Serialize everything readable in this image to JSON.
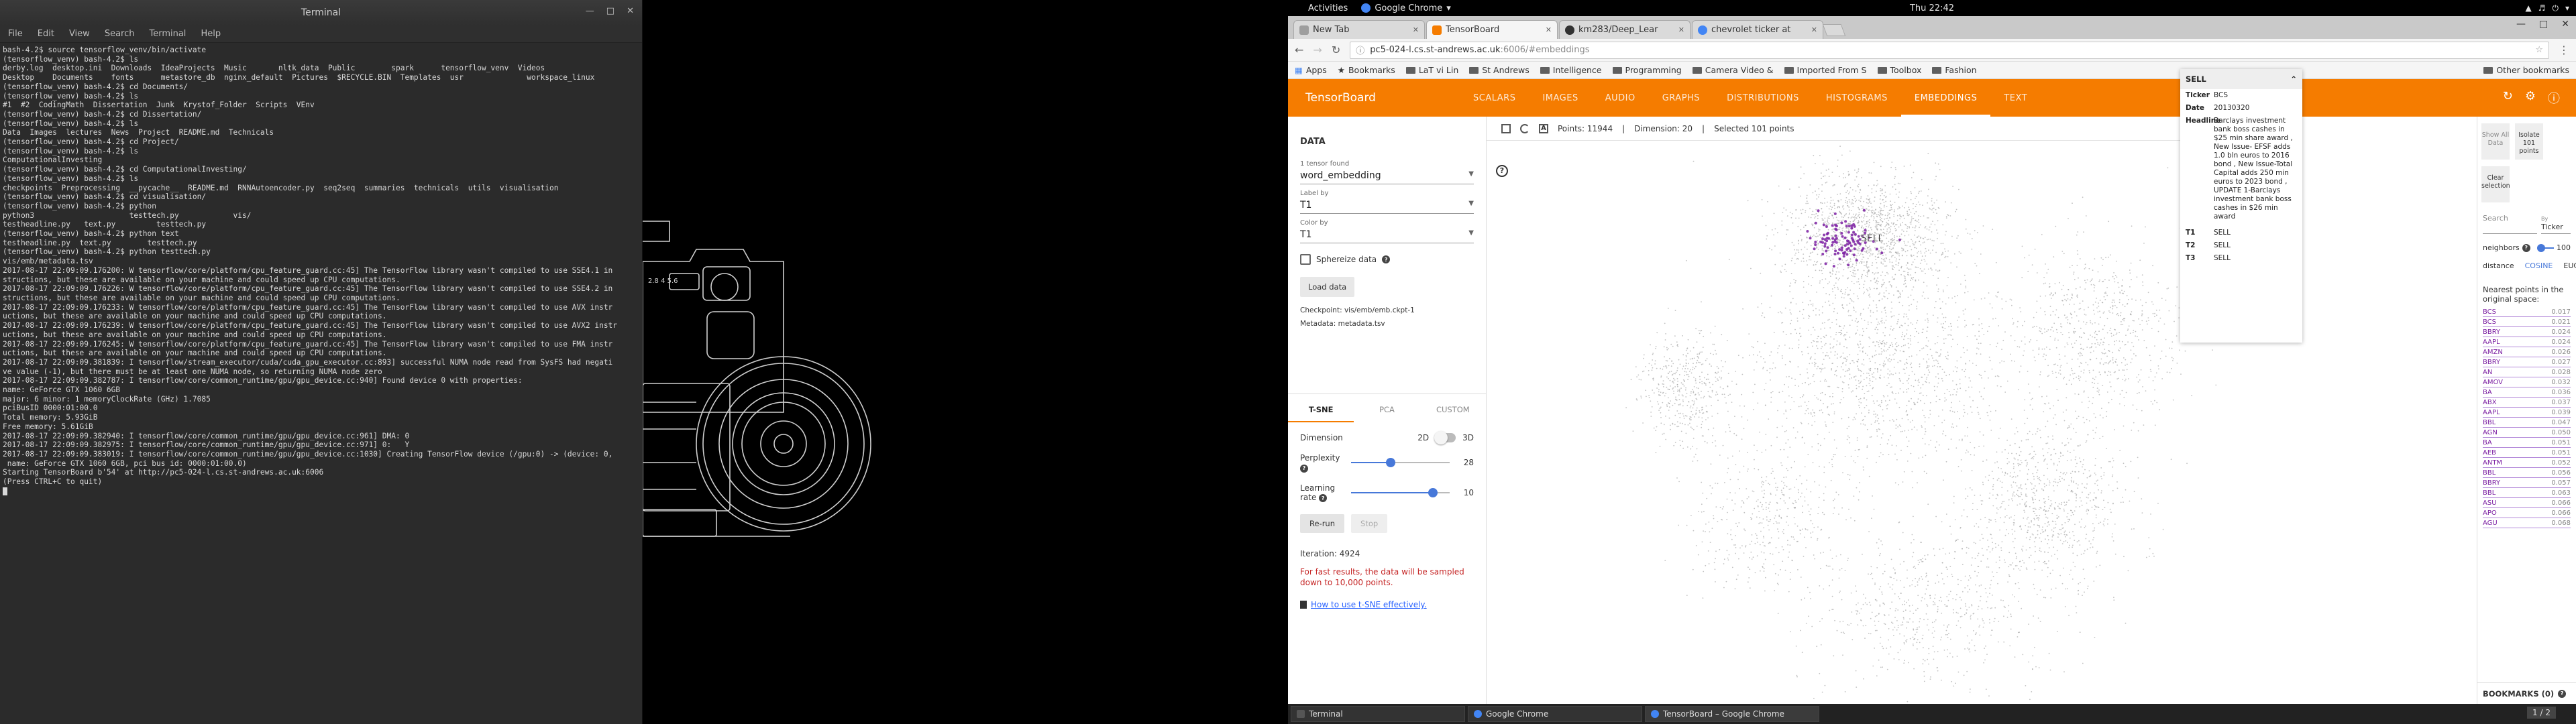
{
  "terminal": {
    "title": "Terminal",
    "menu": [
      "File",
      "Edit",
      "View",
      "Search",
      "Terminal",
      "Help"
    ],
    "lines": [
      "bash-4.2$ source tensorflow_venv/bin/activate",
      "(tensorflow_venv) bash-4.2$ ls",
      "derby.log  desktop.ini  Downloads  IdeaProjects  Music       nltk_data  Public        spark      tensorflow_venv  Videos",
      "Desktop    Documents    fonts      metastore_db  nginx_default  Pictures  $RECYCLE.BIN  Templates  usr              workspace_linux",
      "(tensorflow_venv) bash-4.2$ cd Documents/",
      "(tensorflow_venv) bash-4.2$ ls",
      "#1  #2  CodingMath  Dissertation  Junk  Krystof_Folder  Scripts  VEnv",
      "(tensorflow_venv) bash-4.2$ cd Dissertation/",
      "(tensorflow_venv) bash-4.2$ ls",
      "Data  Images  lectures  News  Project  README.md  Technicals",
      "(tensorflow_venv) bash-4.2$ cd Project/",
      "(tensorflow_venv) bash-4.2$ ls",
      "ComputationalInvesting",
      "(tensorflow_venv) bash-4.2$ cd ComputationalInvesting/",
      "(tensorflow_venv) bash-4.2$ ls",
      "checkpoints  Preprocessing  __pycache__  README.md  RNNAutoencoder.py  seq2seq  summaries  technicals  utils  visualisation",
      "(tensorflow_venv) bash-4.2$ cd visualisation/",
      "(tensorflow_venv) bash-4.2$ python",
      "python3                     testtech.py            vis/",
      "testheadline.py   text.py         testtech.py",
      "(tensorflow_venv) bash-4.2$ python text",
      "testheadline.py  text.py        testtech.py",
      "(tensorflow_venv) bash-4.2$ python testtech.py",
      "vis/emb/metadata.tsv",
      "2017-08-17 22:09:09.176200: W tensorflow/core/platform/cpu_feature_guard.cc:45] The TensorFlow library wasn't compiled to use SSE4.1 in",
      "structions, but these are available on your machine and could speed up CPU computations.",
      "2017-08-17 22:09:09.176226: W tensorflow/core/platform/cpu_feature_guard.cc:45] The TensorFlow library wasn't compiled to use SSE4.2 in",
      "structions, but these are available on your machine and could speed up CPU computations.",
      "2017-08-17 22:09:09.176233: W tensorflow/core/platform/cpu_feature_guard.cc:45] The TensorFlow library wasn't compiled to use AVX instr",
      "uctions, but these are available on your machine and could speed up CPU computations.",
      "2017-08-17 22:09:09.176239: W tensorflow/core/platform/cpu_feature_guard.cc:45] The TensorFlow library wasn't compiled to use AVX2 instr",
      "uctions, but these are available on your machine and could speed up CPU computations.",
      "2017-08-17 22:09:09.176245: W tensorflow/core/platform/cpu_feature_guard.cc:45] The TensorFlow library wasn't compiled to use FMA instr",
      "uctions, but these are available on your machine and could speed up CPU computations.",
      "2017-08-17 22:09:09.381839: I tensorflow/stream_executor/cuda/cuda_gpu_executor.cc:893] successful NUMA node read from SysFS had negati",
      "ve value (-1), but there must be at least one NUMA node, so returning NUMA node zero",
      "2017-08-17 22:09:09.382787: I tensorflow/core/common_runtime/gpu/gpu_device.cc:940] Found device 0 with properties:",
      "name: GeForce GTX 1060 6GB",
      "major: 6 minor: 1 memoryClockRate (GHz) 1.7085",
      "pciBusID 0000:01:00.0",
      "Total memory: 5.93GiB",
      "Free memory: 5.61GiB",
      "2017-08-17 22:09:09.382940: I tensorflow/core/common_runtime/gpu/gpu_device.cc:961] DMA: 0",
      "2017-08-17 22:09:09.382975: I tensorflow/core/common_runtime/gpu/gpu_device.cc:971] 0:   Y",
      "2017-08-17 22:09:09.383019: I tensorflow/core/common_runtime/gpu/gpu_device.cc:1030] Creating TensorFlow device (/gpu:0) -> (device: 0,",
      " name: GeForce GTX 1060 6GB, pci bus id: 0000:01:00.0)",
      "Starting TensorBoard b'54' at http://pc5-024-l.cs.st-andrews.ac.uk:6006",
      "(Press CTRL+C to quit)"
    ]
  },
  "gnome": {
    "activities": "Activities",
    "app": "Google Chrome",
    "clock": "Thu 22:42"
  },
  "chrome": {
    "tabs": [
      {
        "title": "New Tab",
        "color": "#9e9e9e"
      },
      {
        "title": "TensorBoard",
        "color": "#f57c00"
      },
      {
        "title": "km283/Deep_Lear",
        "color": "#333333"
      },
      {
        "title": "chevrolet ticker at",
        "color": "#4285f4"
      }
    ],
    "url_host": "pc5-024-l.cs.st-andrews.ac.uk",
    "url_path": ":6006/#embeddings",
    "bookmarks": [
      "Apps",
      "Bookmarks",
      "LaT vi Lin",
      "St Andrews",
      "Intelligence",
      "Programming",
      "Camera Video &",
      "Imported From S",
      "Toolbox",
      "Fashion"
    ],
    "other_bookmarks": "Other bookmarks"
  },
  "tensorboard": {
    "logo": "TensorBoard",
    "tabs": [
      "SCALARS",
      "IMAGES",
      "AUDIO",
      "GRAPHS",
      "DISTRIBUTIONS",
      "HISTOGRAMS",
      "EMBEDDINGS",
      "TEXT"
    ],
    "active_tab": "EMBEDDINGS",
    "left": {
      "title": "DATA",
      "tensor_label": "1 tensor found",
      "tensor_value": "word_embedding",
      "label_by_label": "Label by",
      "label_by_value": "T1",
      "color_by_label": "Color by",
      "color_by_value": "T1",
      "sphereize": "Sphereize data",
      "load": "Load data",
      "checkpoint_label": "Checkpoint:",
      "checkpoint_value": "vis/emb/emb.ckpt-1",
      "metadata_label": "Metadata:",
      "metadata_value": "metadata.tsv",
      "proj_tabs": [
        "T-SNE",
        "PCA",
        "CUSTOM"
      ],
      "dimension_label": "Dimension",
      "dim_2d": "2D",
      "dim_3d": "3D",
      "perplexity_label": "Perplexity",
      "perplexity_value": 28,
      "perplexity_fraction": 0.4,
      "lr_label": "Learning rate",
      "lr_value": 10,
      "lr_fraction": 0.83,
      "rerun": "Re-run",
      "stop": "Stop",
      "iteration": "Iteration: 4924",
      "warning": "For fast results, the data will be sampled down to 10,000 points.",
      "link": "How to use t-SNE effectively."
    },
    "toolbar": {
      "points": "Points: 11944",
      "dimension": "Dimension: 20",
      "selected": "Selected 101 points"
    },
    "plot_label": "SELL",
    "card": {
      "title": "SELL",
      "rows": [
        {
          "k": "Ticker",
          "v": "BCS"
        },
        {
          "k": "Date",
          "v": "20130320"
        },
        {
          "k": "Headline",
          "v": "Barclays investment bank boss cashes in $25 min share award , New Issue- EFSF adds 1.0 bln euros to 2016 bond , New Issue-Total Capital adds 250 min euros to 2023 bond , UPDATE 1-Barclays investment bank boss cashes in $26 min award"
        },
        {
          "k": "T1",
          "v": "SELL"
        },
        {
          "k": "T2",
          "v": "SELL"
        },
        {
          "k": "T3",
          "v": "SELL"
        }
      ]
    },
    "right": {
      "show_all": "Show All Data",
      "isolate": "Isolate 101 points",
      "clear": "Clear selection",
      "search_placeholder": "Search",
      "by_label": "By",
      "by_value": "Ticker",
      "neighbors_label": "neighbors",
      "neighbors_value": "100",
      "distance_label": "distance",
      "cosine": "COSINE",
      "euclidean": "EUCLIDEAN",
      "nearest_title": "Nearest points in the original space:",
      "nearest": [
        {
          "l": "BCS",
          "v": "0.017"
        },
        {
          "l": "BCS",
          "v": "0.021"
        },
        {
          "l": "BBRY",
          "v": "0.024"
        },
        {
          "l": "AAPL",
          "v": "0.024"
        },
        {
          "l": "AMZN",
          "v": "0.026"
        },
        {
          "l": "BBRY",
          "v": "0.027"
        },
        {
          "l": "AN",
          "v": "0.028"
        },
        {
          "l": "AMOV",
          "v": "0.032"
        },
        {
          "l": "BA",
          "v": "0.036"
        },
        {
          "l": "ABX",
          "v": "0.037"
        },
        {
          "l": "AAPL",
          "v": "0.039"
        },
        {
          "l": "BBL",
          "v": "0.047"
        },
        {
          "l": "AGN",
          "v": "0.050"
        },
        {
          "l": "BA",
          "v": "0.051"
        },
        {
          "l": "AEB",
          "v": "0.051"
        },
        {
          "l": "ANTM",
          "v": "0.052"
        },
        {
          "l": "BBL",
          "v": "0.056"
        },
        {
          "l": "BBRY",
          "v": "0.057"
        },
        {
          "l": "BBL",
          "v": "0.063"
        },
        {
          "l": "ASU",
          "v": "0.066"
        },
        {
          "l": "APO",
          "v": "0.066"
        },
        {
          "l": "AGU",
          "v": "0.068"
        }
      ],
      "bookmarks": "BOOKMARKS (0)"
    }
  },
  "taskbar": {
    "items": [
      "Terminal",
      "Google Chrome",
      "TensorBoard – Google Chrome"
    ],
    "workspace": "1 / 2"
  },
  "colors": {
    "tb_orange": "#f57c00",
    "selected_purple": "#7b1fa2",
    "terminal_bg": "#2b2b2b"
  }
}
